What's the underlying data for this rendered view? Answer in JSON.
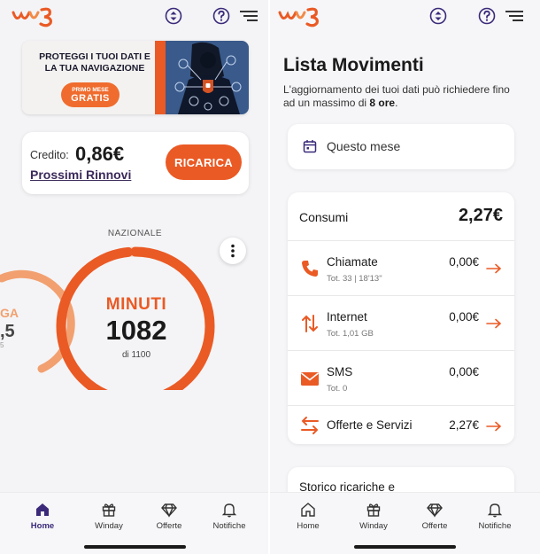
{
  "colors": {
    "brand_orange": "#ea5a25",
    "brand_purple": "#3b2a7a",
    "ring_light": "#f2a070"
  },
  "left": {
    "topbar": {
      "icons": [
        "wind3-logo",
        "sort-icon",
        "help-icon",
        "menu-icon"
      ]
    },
    "banner": {
      "text": "PROTEGGI I TUOI DATI E LA TUA NAVIGAZIONE",
      "pill_small": "PRIMO MESE",
      "pill_big": "GRATIS"
    },
    "credit": {
      "label": "Credito:",
      "value": "0,86€",
      "renewals_link": "Prossimi Rinnovi",
      "recharge_button": "RICARICA"
    },
    "gauge": {
      "section": "NAZIONALE",
      "title": "MINUTI",
      "value": "1082",
      "subtitle": "di 1100",
      "used": 1082,
      "total": 1100,
      "side_partial_a": "GA",
      "side_partial_b": ",5",
      "side_partial_c": "5"
    },
    "nav": [
      {
        "label": "Home",
        "icon": "home-icon",
        "active": true
      },
      {
        "label": "Winday",
        "icon": "gift-icon",
        "active": false
      },
      {
        "label": "Offerte",
        "icon": "diamond-icon",
        "active": false
      },
      {
        "label": "Notifiche",
        "icon": "bell-icon",
        "active": false
      }
    ]
  },
  "right": {
    "title": "Lista Movimenti",
    "subtitle_prefix": "L'aggiornamento dei tuoi dati può richiedere fino ad un massimo di ",
    "subtitle_bold": "8 ore",
    "subtitle_suffix": ".",
    "period": "Questo mese",
    "consumi": {
      "label": "Consumi",
      "total": "2,27€",
      "rows": [
        {
          "name": "Chiamate",
          "meta": "Tot. 33 | 18'13\"",
          "amount": "0,00€",
          "icon": "phone-icon"
        },
        {
          "name": "Internet",
          "meta": "Tot. 1,01 GB",
          "amount": "0,00€",
          "icon": "data-transfer-icon"
        },
        {
          "name": "SMS",
          "meta": "Tot. 0",
          "amount": "0,00€",
          "icon": "envelope-icon"
        },
        {
          "name": "Offerte e Servizi",
          "meta": "",
          "amount": "2,27€",
          "icon": "swap-icon"
        }
      ]
    },
    "storico": "Storico ricariche e",
    "nav": [
      {
        "label": "Home",
        "icon": "home-icon",
        "active": false
      },
      {
        "label": "Winday",
        "icon": "gift-icon",
        "active": false
      },
      {
        "label": "Offerte",
        "icon": "diamond-icon",
        "active": false
      },
      {
        "label": "Notifiche",
        "icon": "bell-icon",
        "active": false
      }
    ]
  }
}
